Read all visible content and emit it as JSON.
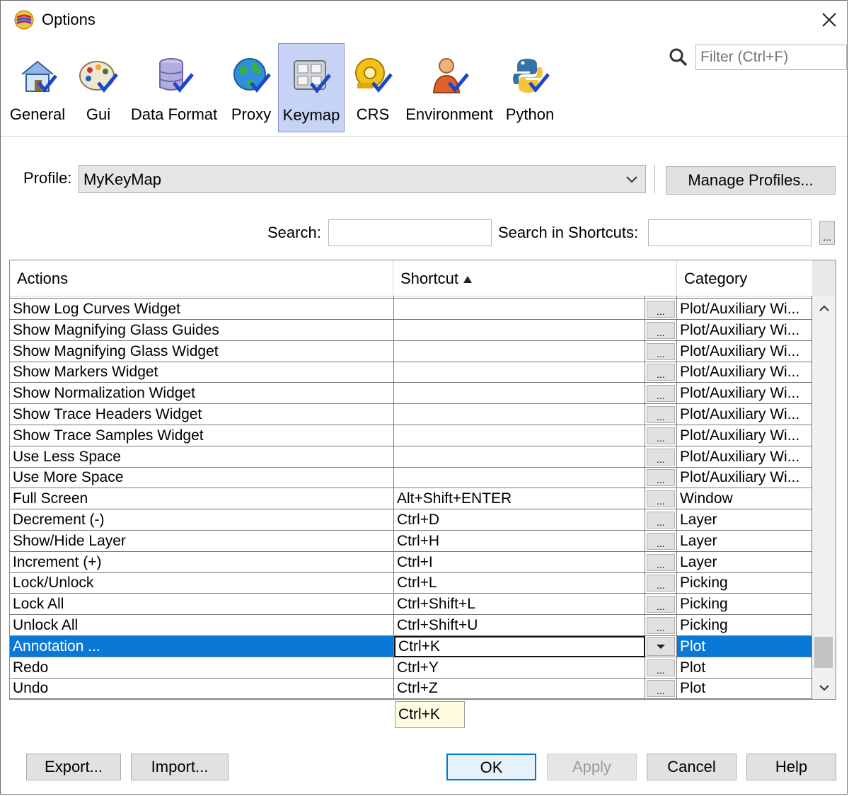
{
  "window": {
    "title": "Options",
    "app_icon": "app-logo-icon",
    "close_icon": "close-icon"
  },
  "toolbar": {
    "items": [
      {
        "label": "General",
        "icon": "house-checkmark-icon"
      },
      {
        "label": "Gui",
        "icon": "palette-checkmark-icon"
      },
      {
        "label": "Data Format",
        "icon": "database-checkmark-icon"
      },
      {
        "label": "Proxy",
        "icon": "globe-checkmark-icon"
      },
      {
        "label": "Keymap",
        "icon": "keyboard-checkmark-icon",
        "selected": true
      },
      {
        "label": "CRS",
        "icon": "tape-checkmark-icon"
      },
      {
        "label": "Environment",
        "icon": "person-checkmark-icon"
      },
      {
        "label": "Python",
        "icon": "python-checkmark-icon"
      }
    ],
    "filter_placeholder": "Filter (Ctrl+F)"
  },
  "profile": {
    "label": "Profile:",
    "value": "MyKeyMap",
    "manage_button": "Manage Profiles..."
  },
  "search": {
    "label": "Search:",
    "shortcut_label": "Search in Shortcuts:",
    "value": "",
    "shortcut_value": "",
    "record_button": "..."
  },
  "table": {
    "headers": {
      "actions": "Actions",
      "shortcut": "Shortcut",
      "category": "Category"
    },
    "sort_column": "Shortcut",
    "sort_direction": "ascending",
    "rows": [
      {
        "action": "Show Log Curves Widget",
        "shortcut": "",
        "category": "Plot/Auxiliary Wi..."
      },
      {
        "action": "Show Magnifying Glass Guides",
        "shortcut": "",
        "category": "Plot/Auxiliary Wi..."
      },
      {
        "action": "Show Magnifying Glass Widget",
        "shortcut": "",
        "category": "Plot/Auxiliary Wi..."
      },
      {
        "action": "Show Markers Widget",
        "shortcut": "",
        "category": "Plot/Auxiliary Wi..."
      },
      {
        "action": "Show Normalization Widget",
        "shortcut": "",
        "category": "Plot/Auxiliary Wi..."
      },
      {
        "action": "Show Trace Headers Widget",
        "shortcut": "",
        "category": "Plot/Auxiliary Wi..."
      },
      {
        "action": "Show Trace Samples Widget",
        "shortcut": "",
        "category": "Plot/Auxiliary Wi..."
      },
      {
        "action": "Use Less Space",
        "shortcut": "",
        "category": "Plot/Auxiliary Wi..."
      },
      {
        "action": "Use More Space",
        "shortcut": "",
        "category": "Plot/Auxiliary Wi..."
      },
      {
        "action": "Full Screen",
        "shortcut": "Alt+Shift+ENTER",
        "category": "Window"
      },
      {
        "action": "Decrement (-)",
        "shortcut": "Ctrl+D",
        "category": "Layer"
      },
      {
        "action": "Show/Hide Layer",
        "shortcut": "Ctrl+H",
        "category": "Layer"
      },
      {
        "action": "Increment (+)",
        "shortcut": "Ctrl+I",
        "category": "Layer"
      },
      {
        "action": "Lock/Unlock",
        "shortcut": "Ctrl+L",
        "category": "Picking"
      },
      {
        "action": "Lock All",
        "shortcut": "Ctrl+Shift+L",
        "category": "Picking"
      },
      {
        "action": "Unlock All",
        "shortcut": "Ctrl+Shift+U",
        "category": "Picking"
      },
      {
        "action": "Annotation ...",
        "shortcut": "Ctrl+K",
        "category": "Plot",
        "selected": true
      },
      {
        "action": "Redo",
        "shortcut": "Ctrl+Y",
        "category": "Plot"
      },
      {
        "action": "Undo",
        "shortcut": "Ctrl+Z",
        "category": "Plot"
      }
    ],
    "row_button": "...",
    "selection_color": "#0a78d7",
    "tooltip": "Ctrl+K"
  },
  "footer": {
    "export": "Export...",
    "import": "Import...",
    "ok": "OK",
    "apply": "Apply",
    "cancel": "Cancel",
    "help": "Help"
  }
}
